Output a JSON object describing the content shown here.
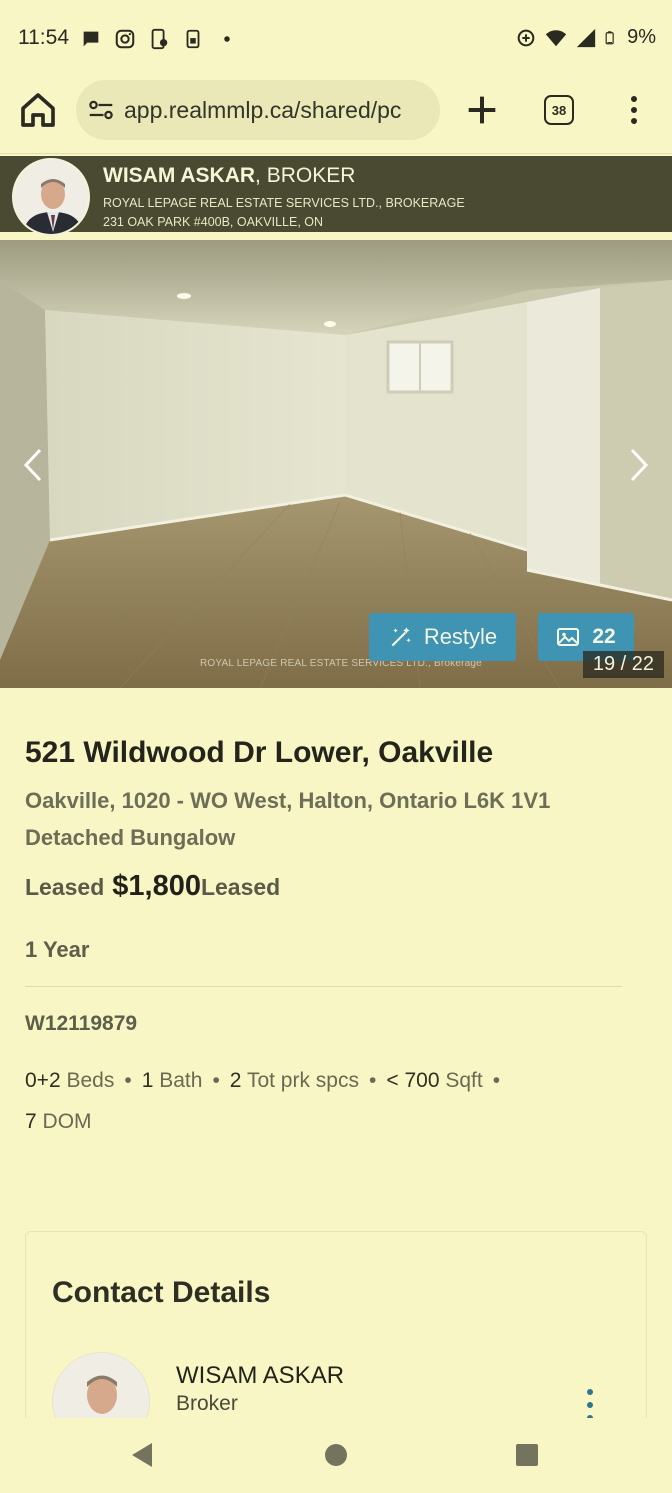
{
  "status_bar": {
    "time": "11:54",
    "battery": "9%",
    "left_icons": [
      "chat-icon",
      "instagram-icon",
      "phone-icon",
      "sim-icon",
      "dot-icon"
    ],
    "right_icons": [
      "data-saver-icon",
      "wifi-icon",
      "signal-icon",
      "battery-icon"
    ]
  },
  "browser": {
    "url": "app.realmmlp.ca/shared/pc",
    "tab_count": "38"
  },
  "agent_banner": {
    "name": "WISAM ASKAR",
    "title": ", BROKER",
    "brokerage": "ROYAL LEPAGE REAL ESTATE SERVICES LTD., BROKERAGE",
    "address": "231 OAK PARK #400B, OAKVILLE, ON"
  },
  "gallery": {
    "restyle_label": "Restyle",
    "photo_count": "22",
    "counter": "19 / 22",
    "watermark": "ROYAL LEPAGE REAL ESTATE SERVICES LTD., Brokerage"
  },
  "listing": {
    "address": "521 Wildwood Dr Lower, Oakville",
    "area": "Oakville, 1020 - WO West, Halton, Ontario L6K 1V1",
    "type": "Detached Bungalow",
    "status_label": "Leased",
    "price": "$1,800",
    "status_suffix": "Leased",
    "term": "1 Year",
    "mls": "W12119879",
    "facts": [
      {
        "num": "0+2",
        "unit": "Beds"
      },
      {
        "num": "1",
        "unit": "Bath"
      },
      {
        "num": "2",
        "unit": "Tot prk spcs"
      },
      {
        "num": "< 700",
        "unit": "Sqft"
      },
      {
        "num": "7",
        "unit": "DOM"
      }
    ]
  },
  "contact": {
    "heading": "Contact Details",
    "name": "WISAM ASKAR",
    "role": "Broker"
  },
  "colors": {
    "background": "#f7f6c4",
    "banner": "#4a4a32",
    "accent_button": "#3f93b3"
  }
}
